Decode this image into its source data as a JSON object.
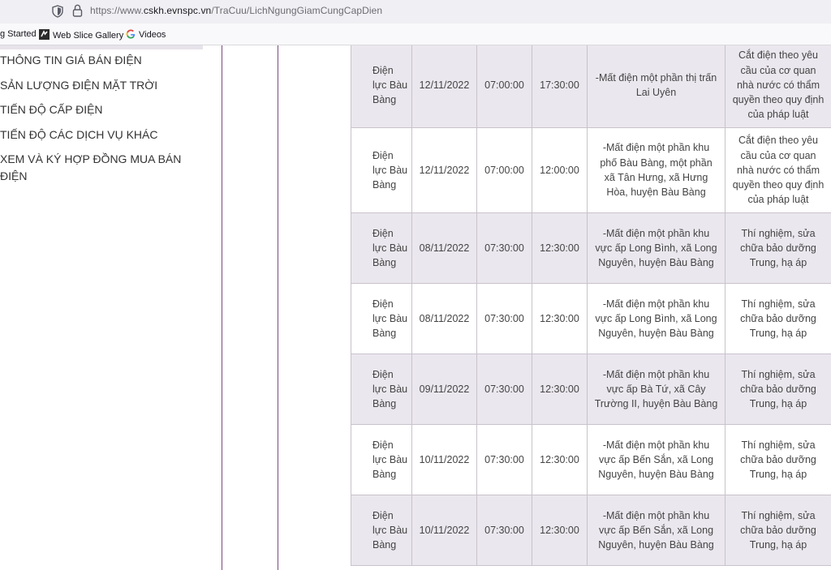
{
  "browser": {
    "url_prefix": "https://www.",
    "url_domain": "cskh.evnspc.vn",
    "url_path": "/TraCuu/LichNgungGiamCungCapDien",
    "bookmarks": [
      "g Started",
      "Web Slice Gallery",
      "Videos"
    ]
  },
  "sidebar": {
    "items": [
      "THÔNG TIN GIÁ BÁN ĐIỆN",
      "SẢN LƯỢNG ĐIỆN MẶT TRỜI",
      "TIẾN ĐỘ CẤP ĐIỆN",
      "TIẾN ĐỘ CÁC DỊCH VỤ KHÁC",
      "XEM VÀ KÝ HỢP ĐỒNG MUA BÁN ĐIỆN"
    ]
  },
  "table": {
    "rows": [
      {
        "unit": "Điện lực Bàu Bàng",
        "date": "12/11/2022",
        "start": "07:00:00",
        "end": "17:30:00",
        "area": "-Mất điện một phần thị trấn Lai Uyên",
        "reason": "Cắt điện theo yêu cầu của cơ quan nhà nước có thẩm quyền theo quy định của pháp luật"
      },
      {
        "unit": "Điện lực Bàu Bàng",
        "date": "12/11/2022",
        "start": "07:00:00",
        "end": "12:00:00",
        "area": "-Mất điện một phần khu phố Bàu Bàng, một phần xã Tân Hưng, xã Hưng Hòa, huyện Bàu Bàng",
        "reason": "Cắt điện theo yêu cầu của cơ quan nhà nước có thẩm quyền theo quy định của pháp luật"
      },
      {
        "unit": "Điện lực Bàu Bàng",
        "date": "08/11/2022",
        "start": "07:30:00",
        "end": "12:30:00",
        "area": "-Mất điện một phần khu vực ấp Long Bình, xã Long Nguyên, huyện Bàu Bàng",
        "reason": "Thí nghiệm, sửa chữa bảo dưỡng Trung, hạ áp"
      },
      {
        "unit": "Điện lực Bàu Bàng",
        "date": "08/11/2022",
        "start": "07:30:00",
        "end": "12:30:00",
        "area": "-Mất điện một phần khu vực ấp Long Bình, xã Long Nguyên, huyện Bàu Bàng",
        "reason": "Thí nghiệm, sửa chữa bảo dưỡng Trung, hạ áp"
      },
      {
        "unit": "Điện lực Bàu Bàng",
        "date": "09/11/2022",
        "start": "07:30:00",
        "end": "12:30:00",
        "area": "-Mất điện một phần khu vực ấp Bà Tứ, xã Cây Trường II, huyện Bàu Bàng",
        "reason": "Thí nghiệm, sửa chữa bảo dưỡng Trung, hạ áp"
      },
      {
        "unit": "Điện lực Bàu Bàng",
        "date": "10/11/2022",
        "start": "07:30:00",
        "end": "12:30:00",
        "area": "-Mất điện một phần khu vực ấp Bến Sắn, xã Long Nguyên, huyện Bàu Bàng",
        "reason": "Thí nghiệm, sửa chữa bảo dưỡng Trung, hạ áp"
      },
      {
        "unit": "Điện lực Bàu Bàng",
        "date": "10/11/2022",
        "start": "07:30:00",
        "end": "12:30:00",
        "area": "-Mất điện một phần khu vực ấp Bến Sắn, xã Long Nguyên, huyện Bàu Bàng",
        "reason": "Thí nghiệm, sửa chữa bảo dưỡng Trung, hạ áp"
      }
    ]
  },
  "colors": {
    "row_shade": "#ebe7ee",
    "divider": "#7a4a7e",
    "text": "#444444"
  }
}
